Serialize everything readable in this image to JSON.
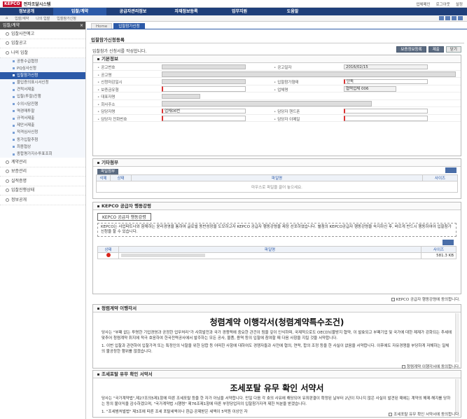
{
  "brand": {
    "logo": "KEPCO",
    "system": "전자조달시스템"
  },
  "util_links": [
    "업체메인",
    "로그아웃",
    "설정"
  ],
  "mainnav": [
    "정보공개",
    "입찰/계약",
    "공급자관리정보",
    "자재정보등록",
    "업무지원",
    "도움말"
  ],
  "breadcrumb": [
    "입찰/계약",
    "나의 입찰",
    "입찰참가신청"
  ],
  "sidebar": {
    "title": "입찰/계약",
    "close": "×",
    "top_items": [
      "입찰사전예고",
      "입찰공고",
      "나의 입찰"
    ],
    "sub_items": [
      "공동수급협정",
      "PQ심사신청",
      "입찰참가신청",
      "물입증의표시서신청",
      "견적서제출",
      "입찰(투찰)진행",
      "수의시담진행",
      "역경매투찰",
      "규격서제출",
      "제안서제출",
      "적격심사신청",
      "동가입찰추첨",
      "최종협상",
      "종합평가지수투표조회"
    ],
    "bottom_items": [
      "계약관리",
      "보증관리",
      "실적증명",
      "입찰진행상태",
      "정보공개"
    ]
  },
  "tabs": [
    "Home",
    "입찰참가신청"
  ],
  "page_title": "입찰참가신청등록",
  "description": "입찰참가 신청서를 작성합니다.",
  "buttons": {
    "save": "보증정보등록",
    "submit": "제출",
    "close": "닫기"
  },
  "basic": {
    "title": "기본정보",
    "labels": {
      "notice_no": "공고번호",
      "notice_date": "공고일자",
      "notice_name": "공고명",
      "apply_deadline": "신청마감일시",
      "bid_type": "입찰참가형태",
      "guarantee_type": "보증금유형",
      "company": "업체명",
      "ceo": "대표자명",
      "address": "회사주소",
      "manager": "담당자명",
      "mobile": "담당자 핸드폰",
      "phone": "담당자 전화번호",
      "email": "담당자 이메일"
    },
    "values": {
      "notice_date": "2016/02/15",
      "bid_type": "단독",
      "company": "협력업체 006",
      "manager": "업체06번"
    }
  },
  "attach": {
    "title": "기타첨부",
    "add_button": "파일첨부",
    "cols": [
      "삭제",
      "상태",
      "파일명",
      "사이즈"
    ],
    "empty_msg": "마우스로 파일을 끌어 놓으세요."
  },
  "kepco": {
    "title": "KEPCO 공급자 행동강령",
    "box_title": "KEPCO 공급자 행동강령",
    "text": "KEPCO는 사업파트너와 함께하는 윤리경영을 통하여 글로벌 동반성장을 도모하고자 KEPCO 공급자 행동강령을 제정 선포하였습니다. 별첨의 KEPCO공급자 행동강령을 숙지하신 후, 바르게 반드시 행동하여야 입찰참가신청을 할 수 있습니다.",
    "cols": [
      "상태",
      "파일명",
      "사이즈"
    ],
    "file_size": "581.3 KB",
    "agree": "KEPCO 공급자 행동강령에 동의합니다."
  },
  "integrity": {
    "title": "청렴계약 이행각서",
    "doc_title": "청렴계약 이행각서(청렴계약특수조건)",
    "text1": "당사는 \"부패 없는 투명한 기업경영과 공정한 업무처리\"가 사회발전과 국가 경쟁력에 중요한 관건이 됨을 깊이 인식하며, 국제적으로도 OECD뇌물방지 협약, 이 발효되고 부패기업 및 국가에 대한 제재가 강화되는 추세에 맞추어 청렴계약 취지에 적극 호응하여 한국전력공사에서 발주하는 모든 공사, 물품, 용역 등의 입찰에 참여할 때 다음 사항을 지킬 것을 서약합니다.",
    "text2": "1. 이번 입찰과 관련하여 입찰가격 또는 특정인의 낙찰을 위한 담합 등 어떠한 사항에 대하여도 경쟁자들과 사전에 협의, 연락, 합의 조정 등을 한 사실이 없음을 서약합니다. 이후에도 자유경쟁을 부당하게 저해하는 일체의 불공정한 행위를 않겠습니다.",
    "agree": "청렴계약 이행각서에 동의합니다."
  },
  "tax": {
    "title": "조세포탈 유무 확인 서약서",
    "doc_title": "조세포탈 유무 확인 서약서",
    "text1": "당사는 \"국가계약법\",제27조의5제1항에 따른 조세포탈 등을 한 자가 아님을 서약합니다. 만일 다음 각 호의 사유에 해당되어 유죄판결이 확정된 날부터 2년이 지나지 않은 사실이 발견된 때에는 계약의 해제·해지를 당하는 등의 불이익을 감수하겠으며, \"국가계약법 시행령\" 제76조제1항에 따른 부정당업자의 입찰참가자격 제한 처분을 받겠습니다.",
    "text2": "1. \"조세범처벌법\" 제3조에 따른 조세 포탈세액이나 환급·공제받은 세액이 5억원 이상인 자",
    "agree": "조세포탈 유무 확인 서약서에 동의합니다."
  }
}
